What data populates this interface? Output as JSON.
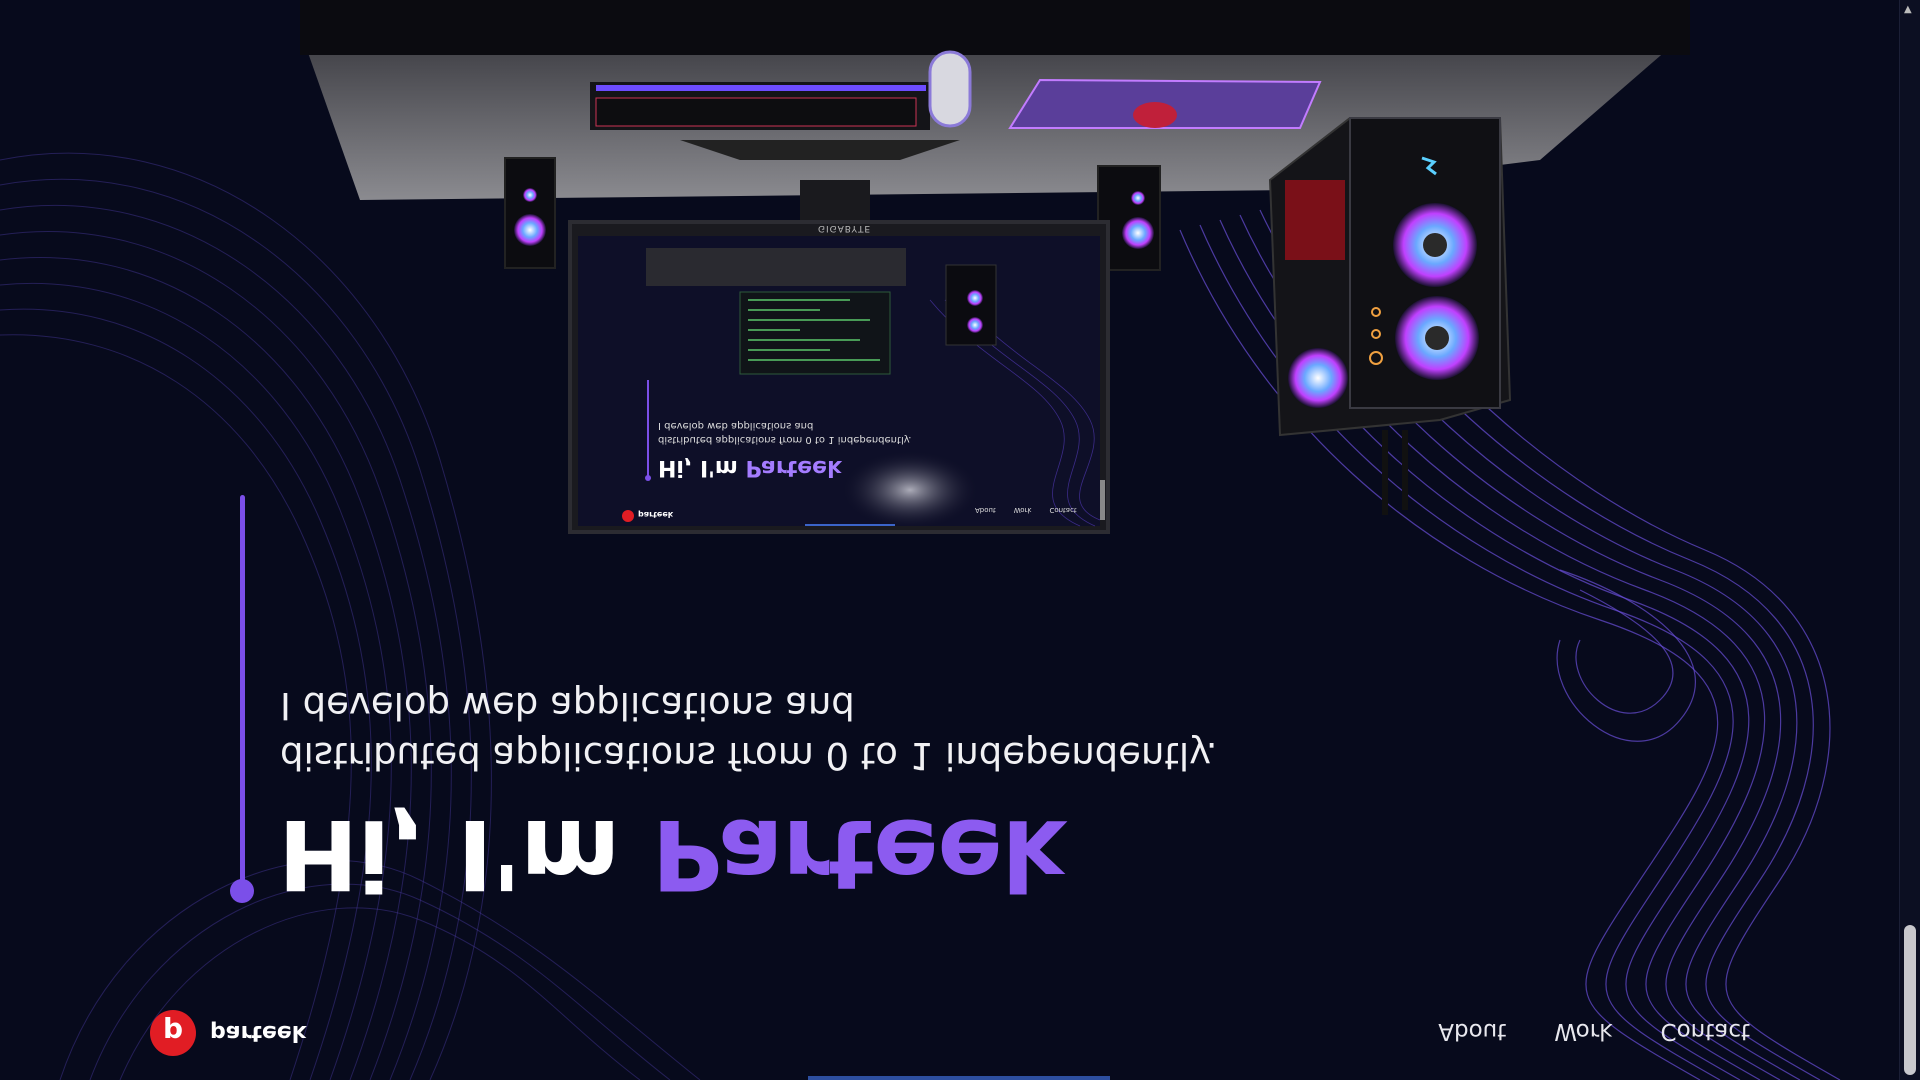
{
  "brand": {
    "logo_letter": "p",
    "name": "parteek",
    "color": "#e11d24"
  },
  "nav": {
    "items": [
      {
        "label": "About"
      },
      {
        "label": "Work"
      },
      {
        "label": "Contact"
      }
    ]
  },
  "hero": {
    "greeting": "Hi, I'm ",
    "name": "Parteek",
    "subtitle_line1": "I develop web applications and",
    "subtitle_line2": "distributed applications from 0 to 1 independently.",
    "accent_color": "#8c5bf0"
  },
  "monitor": {
    "brand": "GIGABYTE",
    "mini_greeting": "Hi, I'm ",
    "mini_name": "Parteek",
    "mini_sub1": "I develop web applications and",
    "mini_sub2": "distributed applications from 0 to 1 independently.",
    "mini_logo": "parteek",
    "mini_nav": [
      "About",
      "Work",
      "Contact"
    ]
  },
  "colors": {
    "background": "#070a1c",
    "accent": "#8c5bf0",
    "text": "#ffffff"
  }
}
